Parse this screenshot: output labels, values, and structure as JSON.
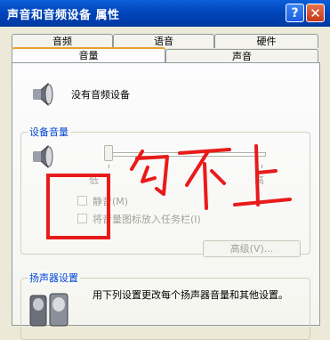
{
  "window": {
    "title": "声音和音频设备 属性",
    "help_button": "?",
    "close_button": "✕"
  },
  "tabs_back": [
    "音频",
    "语音",
    "硬件"
  ],
  "tabs_front": [
    "音量",
    "声音"
  ],
  "active_tab": "音量",
  "no_device_text": "没有音频设备",
  "device_volume": {
    "group_title": "设备音量",
    "low_label": "低",
    "high_label": "高",
    "slider_level": 0,
    "mute_label": "静音(M)",
    "tray_icon_label": "将音量图标放入任务栏(I)",
    "advanced_button": "高级(V)..."
  },
  "speaker_settings": {
    "group_title": "扬声器设置",
    "description": "用下列设置更改每个扬声器音量和其他设置。"
  },
  "annotation": {
    "handwritten_text": "勾不上",
    "color": "#e81b1b"
  },
  "icons": [
    "help-icon",
    "close-icon",
    "speaker-icon",
    "speaker-set-icon"
  ]
}
